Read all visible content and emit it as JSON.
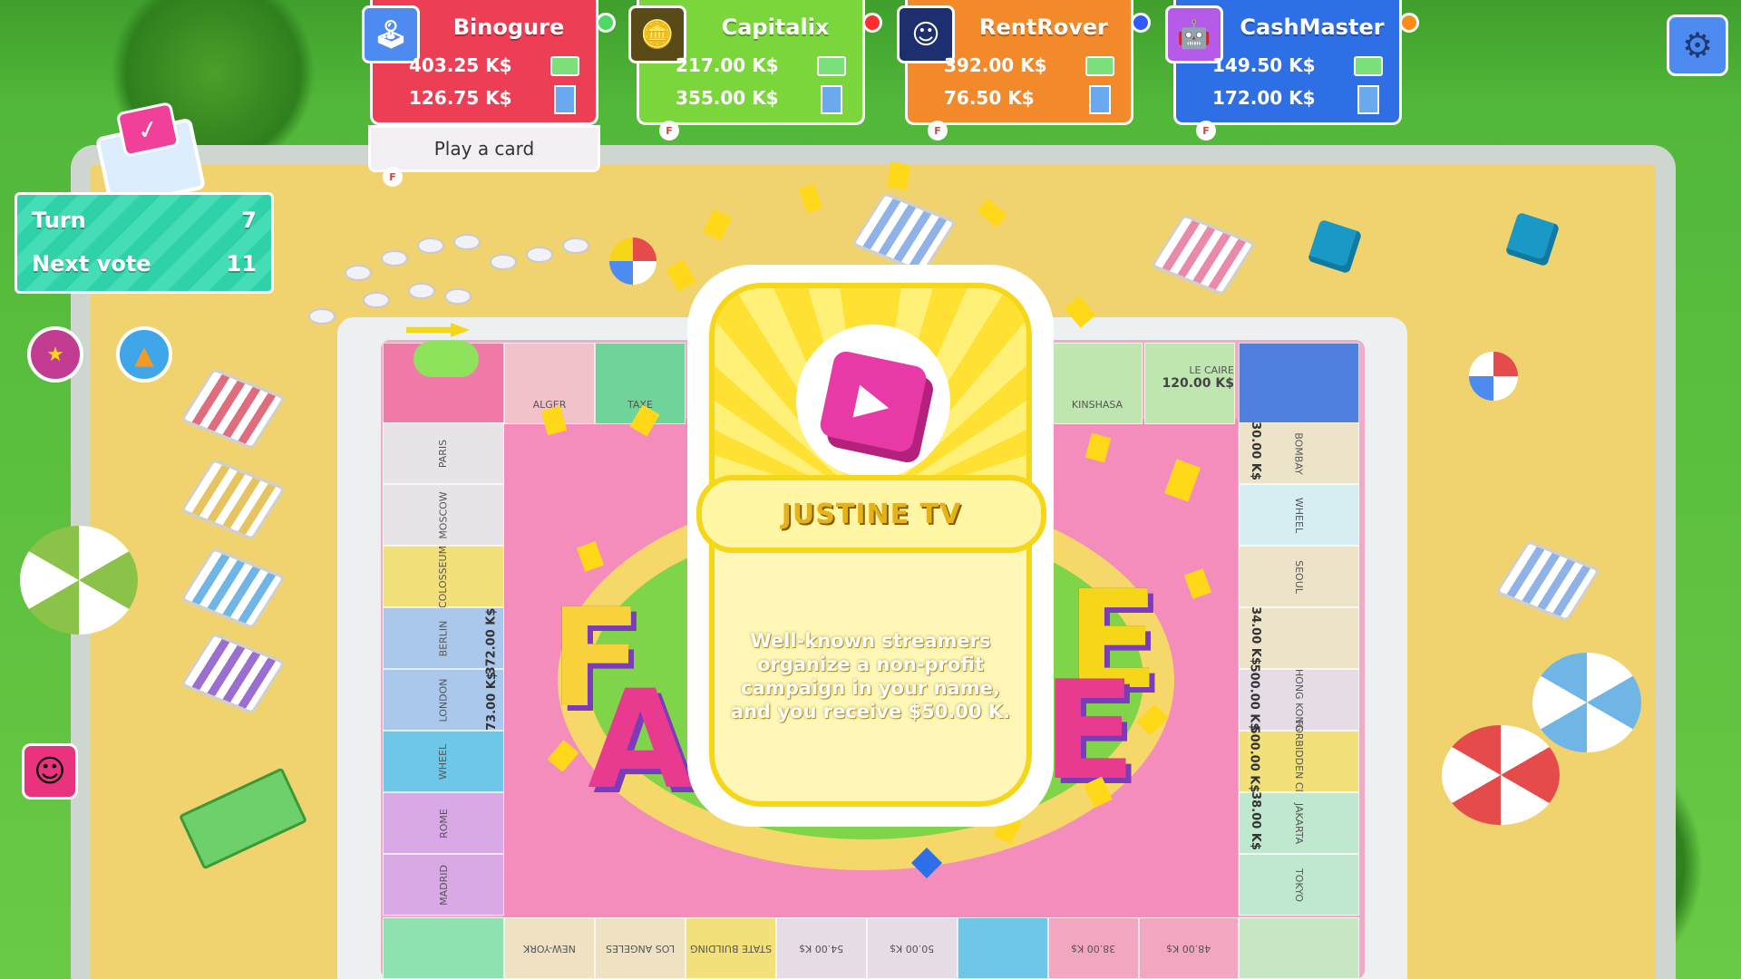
{
  "players": [
    {
      "name": "Binogure",
      "money": "403.25 K$",
      "assets": "126.75 K$",
      "color": "#ee3e55",
      "dot": "#4cd964",
      "avatar_icon": "joystick-icon"
    },
    {
      "name": "Capitalix",
      "money": "217.00 K$",
      "assets": "355.00 K$",
      "color": "#7ad63a",
      "dot": "#ff2d2d",
      "avatar_icon": "coins-icon"
    },
    {
      "name": "RentRover",
      "money": "392.00 K$",
      "assets": "76.50 K$",
      "color": "#f2892a",
      "dot": "#2d5bff",
      "avatar_icon": "mascot-icon"
    },
    {
      "name": "CashMaster",
      "money": "149.50 K$",
      "assets": "172.00 K$",
      "color": "#2f6fe6",
      "dot": "#ff8a1a",
      "avatar_icon": "robot-icon"
    }
  ],
  "play_card_label": "Play a card",
  "turn_panel": {
    "turn_label": "Turn",
    "turn_value": "7",
    "vote_label": "Next vote",
    "vote_value": "11"
  },
  "event_card": {
    "title": "JUSTINE TV",
    "description": "Well-known streamers organize a non-profit campaign in your name, and you receive $50.00 K.",
    "icon": "play-button-icon"
  },
  "board": {
    "top_tiles": [
      "ALGER",
      "TAXE",
      "KINSHASA",
      "LE CAIRE"
    ],
    "top_price": "120.00 K$",
    "left_tiles": [
      "PARIS",
      "MOSCOW",
      "COLOSSEUM",
      "BERLIN",
      "LONDON",
      "WHEEL",
      "ROME",
      "MADRID"
    ],
    "left_prices": [
      "372.00 K$",
      "73.00 K$"
    ],
    "right_tiles": [
      "BOMBAY",
      "WHEEL",
      "SEOUL",
      "",
      "HONG KONG",
      "FORBIDDEN CITY",
      "JAKARTA",
      "TOKYO"
    ],
    "right_prices": [
      "30.00 K$",
      "34.00 K$",
      "500.00 K$",
      "500.00 K$",
      "38.00 K$"
    ],
    "bottom_tiles": [
      "NEW-YORK",
      "LOS ANGELES",
      "STATE BUILDING"
    ],
    "bottom_prices": [
      "54.00 K$",
      "50.00 K$",
      "38.00 K$",
      "48.00 K$"
    ]
  }
}
